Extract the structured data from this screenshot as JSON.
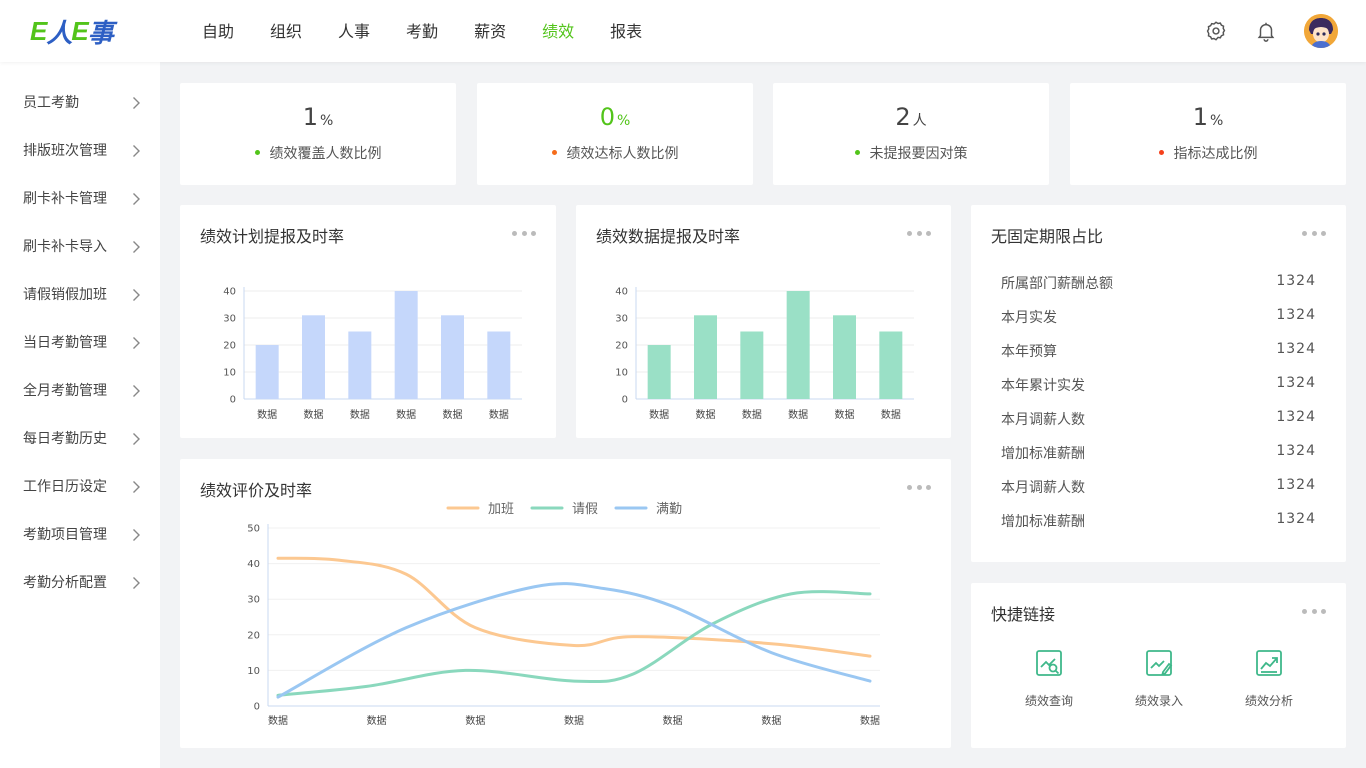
{
  "header": {
    "logo": {
      "part1": "E",
      "part2": "人",
      "part3": "E",
      "part4": "事"
    },
    "nav": [
      "自助",
      "组织",
      "人事",
      "考勤",
      "薪资",
      "绩效",
      "报表"
    ],
    "active_nav": "绩效"
  },
  "sidebar": {
    "items": [
      "员工考勤",
      "排版班次管理",
      "刷卡补卡管理",
      "刷卡补卡导入",
      "请假销假加班",
      "当日考勤管理",
      "全月考勤管理",
      "每日考勤历史",
      "工作日历设定",
      "考勤项目管理",
      "考勤分析配置"
    ]
  },
  "stats": [
    {
      "value": "1",
      "unit": "%",
      "label": "绩效覆盖人数比例",
      "dot_color": "#52c41a",
      "value_color": "#444444"
    },
    {
      "value": "0",
      "unit": "%",
      "label": "绩效达标人数比例",
      "dot_color": "#f56c1b",
      "value_color": "#52c41a"
    },
    {
      "value": "2",
      "unit": "人",
      "label": "未提报要因对策",
      "dot_color": "#52c41a",
      "value_color": "#444444"
    },
    {
      "value": "1",
      "unit": "%",
      "label": "指标达成比例",
      "dot_color": "#f5401b",
      "value_color": "#444444"
    }
  ],
  "cards": {
    "plan": {
      "title": "绩效计划提报及时率"
    },
    "data": {
      "title": "绩效数据提报及时率"
    },
    "eval": {
      "title": "绩效评价及时率"
    },
    "ratio": {
      "title": "无固定期限占比"
    },
    "quick": {
      "title": "快捷链接"
    }
  },
  "ratio_list": [
    {
      "label": "所属部门薪酬总额",
      "value": "1324"
    },
    {
      "label": "本月实发",
      "value": "1324"
    },
    {
      "label": "本年预算",
      "value": "1324"
    },
    {
      "label": "本年累计实发",
      "value": "1324"
    },
    {
      "label": "本月调薪人数",
      "value": "1324"
    },
    {
      "label": "增加标准薪酬",
      "value": "1324"
    },
    {
      "label": "本月调薪人数",
      "value": "1324"
    },
    {
      "label": "增加标准薪酬",
      "value": "1324"
    }
  ],
  "quick_links": [
    {
      "label": "绩效查询",
      "icon": "search-chart-icon"
    },
    {
      "label": "绩效录入",
      "icon": "edit-chart-icon"
    },
    {
      "label": "绩效分析",
      "icon": "trend-chart-icon"
    }
  ],
  "chart_data": [
    {
      "type": "bar",
      "title": "绩效计划提报及时率",
      "categories": [
        "数据",
        "数据",
        "数据",
        "数据",
        "数据",
        "数据"
      ],
      "values": [
        20,
        31,
        25,
        40,
        31,
        25
      ],
      "ylim": [
        0,
        40
      ],
      "yticks": [
        0,
        10,
        20,
        30,
        40
      ],
      "color": "#c5d7fb",
      "grid": true
    },
    {
      "type": "bar",
      "title": "绩效数据提报及时率",
      "categories": [
        "数据",
        "数据",
        "数据",
        "数据",
        "数据",
        "数据"
      ],
      "values": [
        20,
        31,
        25,
        40,
        31,
        25
      ],
      "ylim": [
        0,
        40
      ],
      "yticks": [
        0,
        10,
        20,
        30,
        40
      ],
      "color": "#9ae0c6",
      "grid": true
    },
    {
      "type": "line",
      "title": "绩效评价及时率",
      "categories": [
        "数据",
        "数据",
        "数据",
        "数据",
        "数据",
        "数据",
        "数据"
      ],
      "ylim": [
        0,
        50
      ],
      "yticks": [
        0,
        10,
        20,
        30,
        40,
        50
      ],
      "legend": "top-center",
      "grid": true,
      "series": [
        {
          "name": "加班",
          "color": "#fcc891",
          "x": [
            0,
            0.6,
            1.3,
            2.0,
            3.0,
            3.6,
            5.0,
            6.0
          ],
          "values": [
            41.5,
            41,
            37,
            22,
            17,
            19.5,
            17.5,
            14
          ]
        },
        {
          "name": "请假",
          "color": "#8ad8bd",
          "x": [
            0,
            0.9,
            1.9,
            3.0,
            3.6,
            4.4,
            5.2,
            6.0
          ],
          "values": [
            3,
            5.5,
            10,
            7,
            9,
            23,
            31.5,
            31.5
          ]
        },
        {
          "name": "满勤",
          "color": "#9ac7f2",
          "x": [
            0,
            1.3,
            2.6,
            3.3,
            4.0,
            5.0,
            6.0
          ],
          "values": [
            2.5,
            22,
            33.5,
            33,
            28,
            15,
            7
          ]
        }
      ]
    }
  ]
}
